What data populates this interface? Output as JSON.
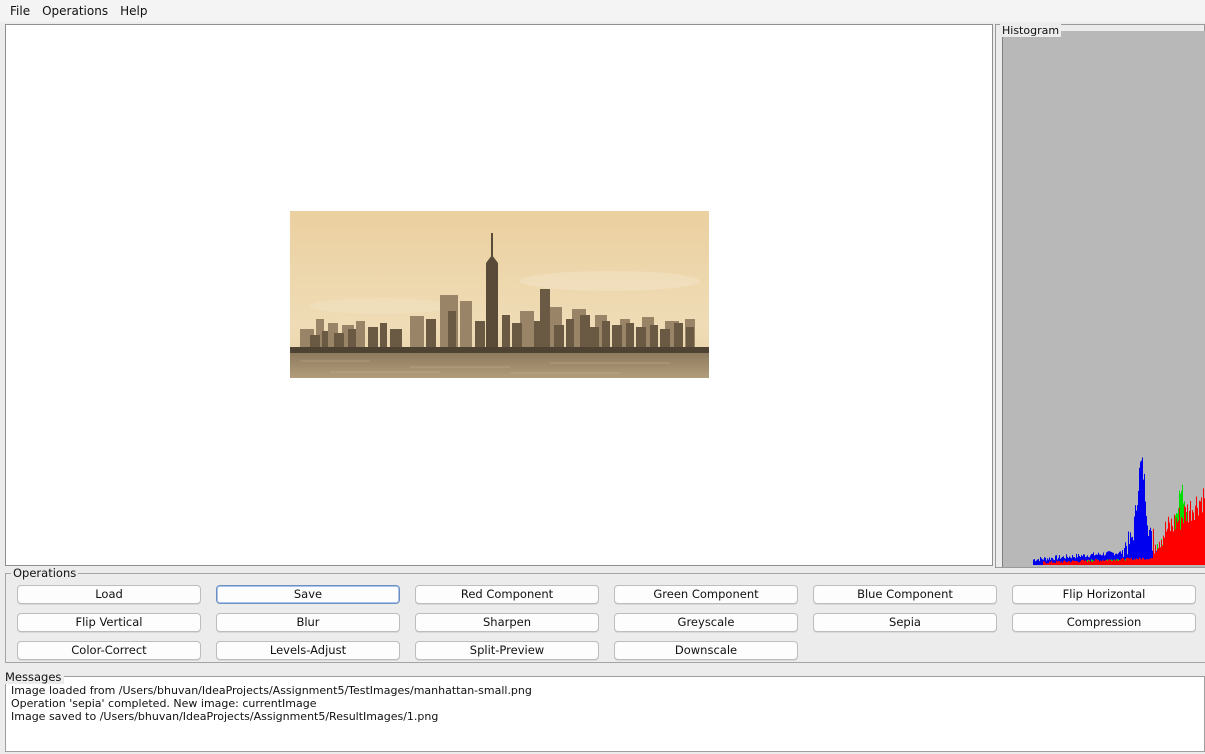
{
  "menu": {
    "file": "File",
    "operations": "Operations",
    "help": "Help"
  },
  "histogram": {
    "title": "Histogram"
  },
  "operations": {
    "title": "Operations",
    "buttons": {
      "load": "Load",
      "save": "Save",
      "red_component": "Red Component",
      "green_component": "Green Component",
      "blue_component": "Blue Component",
      "flip_horizontal": "Flip Horizontal",
      "flip_vertical": "Flip Vertical",
      "blur": "Blur",
      "sharpen": "Sharpen",
      "greyscale": "Greyscale",
      "sepia": "Sepia",
      "compression": "Compression",
      "color_correct": "Color-Correct",
      "levels_adjust": "Levels-Adjust",
      "split_preview": "Split-Preview",
      "downscale": "Downscale"
    }
  },
  "messages": {
    "title": "Messages",
    "lines": [
      "Image loaded from /Users/bhuvan/IdeaProjects/Assignment5/TestImages/manhattan-small.png",
      "Operation 'sepia' completed. New image: currentImage",
      "Image saved to /Users/bhuvan/IdeaProjects/Assignment5/ResultImages/1.png"
    ]
  },
  "colors": {
    "histogram_red": "#ff0000",
    "histogram_green": "#00e000",
    "histogram_blue": "#0000ee",
    "sepia_sky": "#ebd3a6",
    "sepia_building": "#6a5a44"
  }
}
